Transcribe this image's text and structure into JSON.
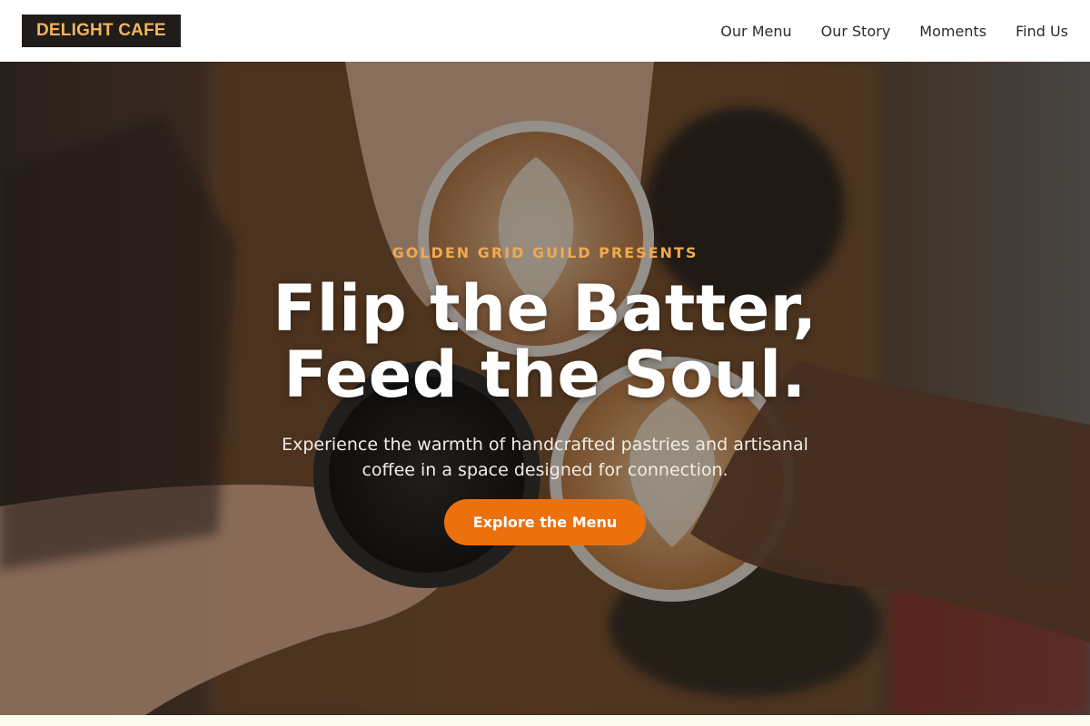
{
  "brand": {
    "name": "DELIGHT CAFE"
  },
  "nav": {
    "items": [
      {
        "label": "Our Menu"
      },
      {
        "label": "Our Story"
      },
      {
        "label": "Moments"
      },
      {
        "label": "Find Us"
      }
    ]
  },
  "hero": {
    "eyebrow": "GOLDEN GRID GUILD PRESENTS",
    "headline_line1": "Flip the Batter,",
    "headline_line2": "Feed the Soul.",
    "subtext": "Experience the warmth of handcrafted pastries and artisanal coffee in a space designed for connection.",
    "cta_label": "Explore the Menu"
  },
  "colors": {
    "logo_bg": "#1f1c1a",
    "logo_text": "#f2b45c",
    "eyebrow": "#f2a94f",
    "cta": "#ec700c"
  }
}
